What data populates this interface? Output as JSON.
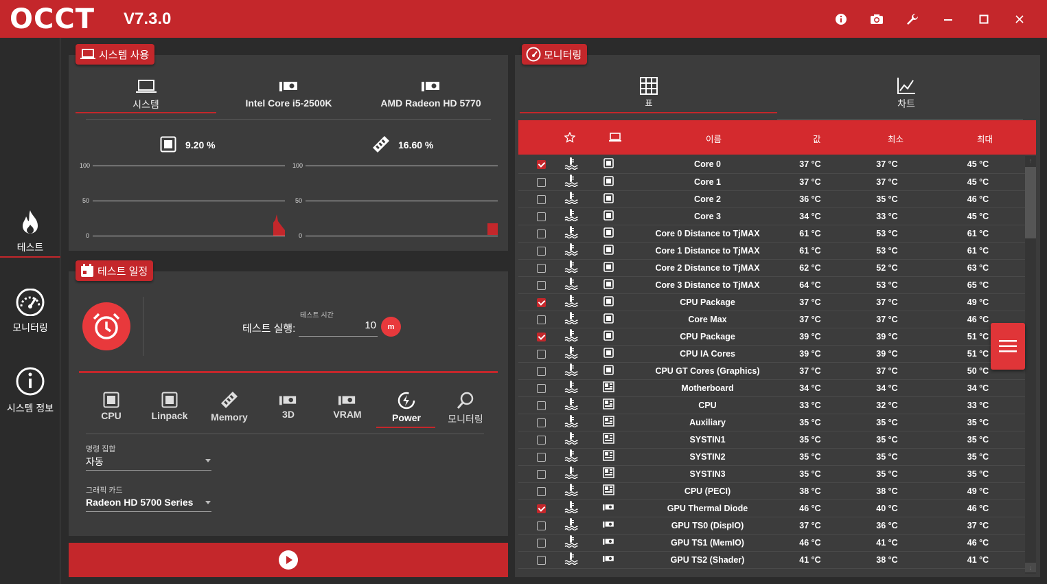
{
  "app": {
    "logo": "OCCT",
    "version": "V7.3.0"
  },
  "window_buttons": [
    "info-icon",
    "camera-icon",
    "wrench-icon",
    "minimize-icon",
    "maximize-icon",
    "close-icon"
  ],
  "sidebar": {
    "items": [
      {
        "label": "테스트",
        "icon": "flame-icon",
        "active": true
      },
      {
        "label": "모니터링",
        "icon": "gauge-icon",
        "active": false
      },
      {
        "label": "시스템 정보",
        "icon": "info-icon",
        "active": false
      }
    ]
  },
  "system_usage": {
    "tag": "시스템 사용",
    "tabs": [
      "시스템",
      "Intel Core i5-2500K",
      "AMD Radeon HD 5770"
    ],
    "cpu_usage": "9.20 %",
    "mem_usage": "16.60 %",
    "axis": [
      "100",
      "50",
      "0"
    ]
  },
  "schedule": {
    "tag": "테스트 일정",
    "run_label": "테스트 실행:",
    "duration_label": "테스트 시간",
    "duration_value": "10",
    "unit": "m",
    "tests": [
      "CPU",
      "Linpack",
      "Memory",
      "3D",
      "VRAM",
      "Power",
      "모니터링"
    ],
    "active_test": "Power",
    "instruction_set_label": "명령 집합",
    "instruction_set_value": "자동",
    "gpu_label": "그래픽 카드",
    "gpu_value": "Radeon HD 5700 Series"
  },
  "monitoring": {
    "tag": "모니터링",
    "tabs": [
      "표",
      "차트"
    ],
    "columns": [
      "이름",
      "값",
      "최소",
      "최대"
    ],
    "rows": [
      {
        "checked": true,
        "dev": "cpu",
        "name": "Core 0",
        "val": "37 °C",
        "min": "37 °C",
        "max": "45 °C"
      },
      {
        "checked": false,
        "dev": "cpu",
        "name": "Core 1",
        "val": "37 °C",
        "min": "37 °C",
        "max": "45 °C"
      },
      {
        "checked": false,
        "dev": "cpu",
        "name": "Core 2",
        "val": "36 °C",
        "min": "35 °C",
        "max": "46 °C"
      },
      {
        "checked": false,
        "dev": "cpu",
        "name": "Core 3",
        "val": "34 °C",
        "min": "33 °C",
        "max": "45 °C"
      },
      {
        "checked": false,
        "dev": "cpu",
        "name": "Core 0 Distance to TjMAX",
        "val": "61 °C",
        "min": "53 °C",
        "max": "61 °C"
      },
      {
        "checked": false,
        "dev": "cpu",
        "name": "Core 1 Distance to TjMAX",
        "val": "61 °C",
        "min": "53 °C",
        "max": "61 °C"
      },
      {
        "checked": false,
        "dev": "cpu",
        "name": "Core 2 Distance to TjMAX",
        "val": "62 °C",
        "min": "52 °C",
        "max": "63 °C"
      },
      {
        "checked": false,
        "dev": "cpu",
        "name": "Core 3 Distance to TjMAX",
        "val": "64 °C",
        "min": "53 °C",
        "max": "65 °C"
      },
      {
        "checked": true,
        "dev": "cpu",
        "name": "CPU Package",
        "val": "37 °C",
        "min": "37 °C",
        "max": "49 °C"
      },
      {
        "checked": false,
        "dev": "cpu",
        "name": "Core Max",
        "val": "37 °C",
        "min": "37 °C",
        "max": "46 °C"
      },
      {
        "checked": true,
        "dev": "cpu",
        "name": "CPU Package",
        "val": "39 °C",
        "min": "39 °C",
        "max": "51 °C"
      },
      {
        "checked": false,
        "dev": "cpu",
        "name": "CPU IA Cores",
        "val": "39 °C",
        "min": "39 °C",
        "max": "51 °C"
      },
      {
        "checked": false,
        "dev": "cpu",
        "name": "CPU GT Cores (Graphics)",
        "val": "37 °C",
        "min": "37 °C",
        "max": "50 °C"
      },
      {
        "checked": false,
        "dev": "mb",
        "name": "Motherboard",
        "val": "34 °C",
        "min": "34 °C",
        "max": "34 °C"
      },
      {
        "checked": false,
        "dev": "mb",
        "name": "CPU",
        "val": "33 °C",
        "min": "32 °C",
        "max": "33 °C"
      },
      {
        "checked": false,
        "dev": "mb",
        "name": "Auxiliary",
        "val": "35 °C",
        "min": "35 °C",
        "max": "35 °C"
      },
      {
        "checked": false,
        "dev": "mb",
        "name": "SYSTIN1",
        "val": "35 °C",
        "min": "35 °C",
        "max": "35 °C"
      },
      {
        "checked": false,
        "dev": "mb",
        "name": "SYSTIN2",
        "val": "35 °C",
        "min": "35 °C",
        "max": "35 °C"
      },
      {
        "checked": false,
        "dev": "mb",
        "name": "SYSTIN3",
        "val": "35 °C",
        "min": "35 °C",
        "max": "35 °C"
      },
      {
        "checked": false,
        "dev": "mb",
        "name": "CPU (PECI)",
        "val": "38 °C",
        "min": "38 °C",
        "max": "49 °C"
      },
      {
        "checked": true,
        "dev": "gpu",
        "name": "GPU Thermal Diode",
        "val": "46 °C",
        "min": "40 °C",
        "max": "46 °C"
      },
      {
        "checked": false,
        "dev": "gpu",
        "name": "GPU TS0 (DispIO)",
        "val": "37 °C",
        "min": "36 °C",
        "max": "37 °C"
      },
      {
        "checked": false,
        "dev": "gpu",
        "name": "GPU TS1 (MemIO)",
        "val": "46 °C",
        "min": "41 °C",
        "max": "46 °C"
      },
      {
        "checked": false,
        "dev": "gpu",
        "name": "GPU TS2 (Shader)",
        "val": "41 °C",
        "min": "38 °C",
        "max": "41 °C"
      }
    ]
  },
  "colors": {
    "accent": "#c4272b",
    "panel": "#3c3c3c",
    "bg": "#2b2b2b"
  }
}
